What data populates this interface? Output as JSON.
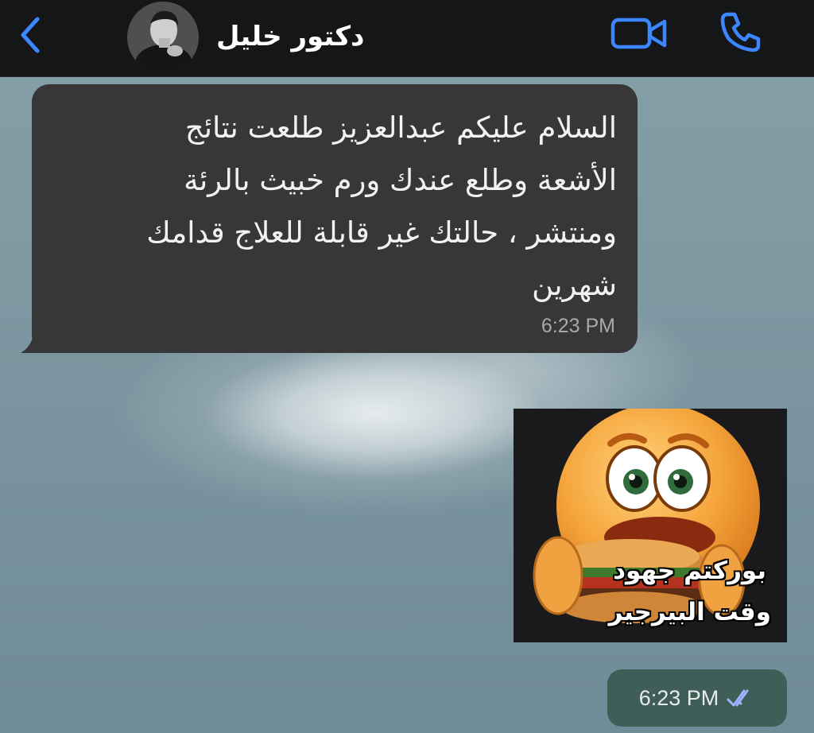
{
  "header": {
    "contact_name": "دكتور خليل",
    "back_icon": "chevron-left-icon",
    "video_icon": "video-camera-icon",
    "call_icon": "phone-icon",
    "accent_color": "#3c86ff"
  },
  "messages": {
    "incoming": {
      "lines": [
        "السلام عليكم عبدالعزيز طلعت نتائج",
        "الأشعة وطلع عندك ورم خبيث بالرئة",
        "ومنتشر ، حالتك غير قابلة للعلاج قدامك",
        "شهرين"
      ],
      "time": "6:23 PM"
    },
    "outgoing": {
      "sticker_caption": [
        "بوركتم جهود",
        "وقت البيرجير"
      ],
      "sticker_icon": "scared-emoji-eating-burger",
      "time": "6:23 PM",
      "status_icon": "double-check-icon"
    }
  }
}
